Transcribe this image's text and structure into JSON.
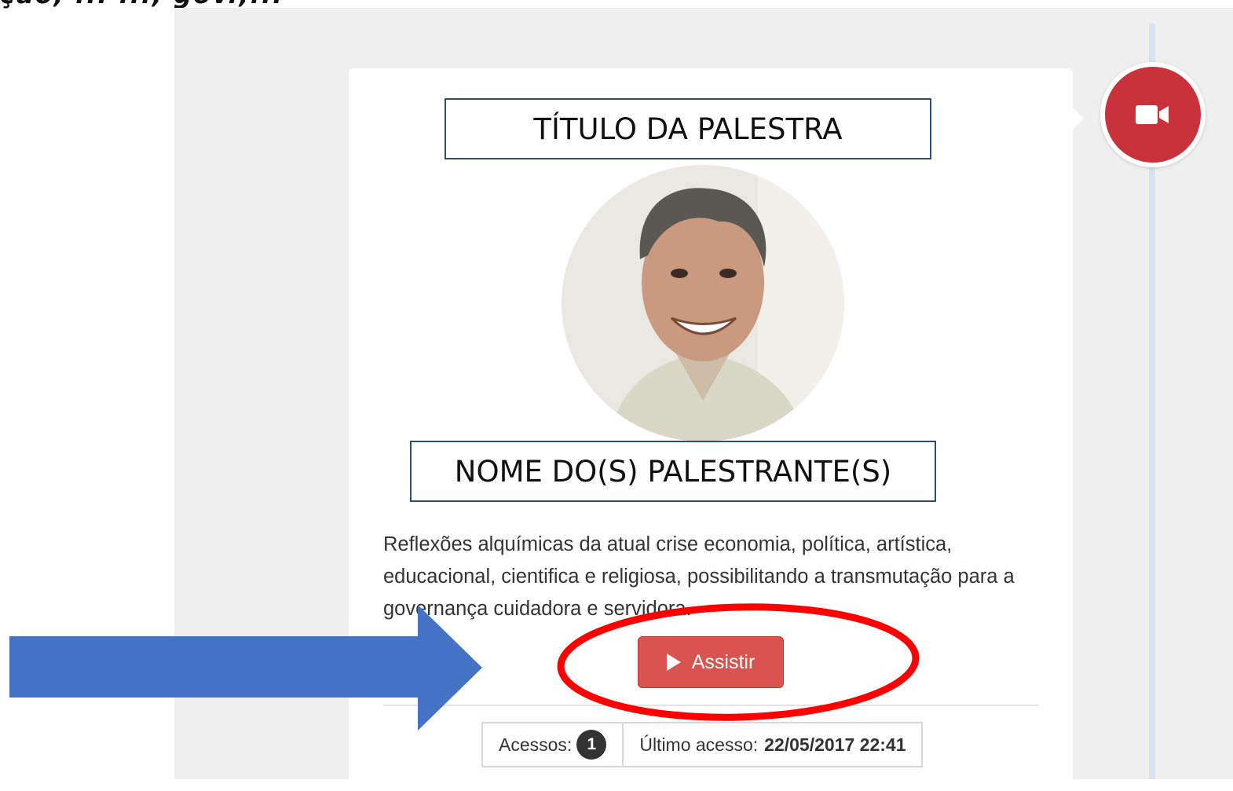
{
  "header": {
    "partial_text": "ção, ... ..., gov.,..."
  },
  "talk": {
    "title": "TÍTULO DA PALESTRA",
    "speaker": "NOME DO(S) PALESTRANTE(S)",
    "description": "Reflexões alquímicas da atual crise economia, política, artística, educacional, cientifica e religiosa, possibilitando a transmutação para a governança cuidadora e servidora.",
    "watch_label": "Assistir"
  },
  "stats": {
    "accesses_label": "Acessos:",
    "accesses_count": "1",
    "last_access_label": "Último acesso:",
    "last_access_value": "22/05/2017 22:41"
  },
  "icons": {
    "timeline_badge": "video-camera-icon",
    "watch": "play-icon"
  },
  "colors": {
    "badge_red": "#c9323a",
    "button_red": "#d9534f",
    "annotation_arrow": "#4472c4",
    "annotation_ellipse": "#ff0000",
    "box_border": "#2f4a7e"
  }
}
